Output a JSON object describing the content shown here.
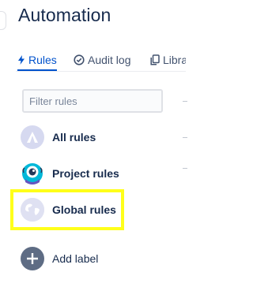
{
  "header": {
    "title": "Automation"
  },
  "tabs": [
    {
      "label": "Rules",
      "icon": "lightning-icon",
      "active": true
    },
    {
      "label": "Audit log",
      "icon": "check-circle-icon",
      "active": false
    },
    {
      "label": "Libra",
      "icon": "copy-icon",
      "active": false
    }
  ],
  "filter": {
    "placeholder": "Filter rules",
    "value": ""
  },
  "sidebar": {
    "items": [
      {
        "label": "All rules",
        "icon": "all-rules-icon"
      },
      {
        "label": "Project rules",
        "icon": "project-avatar-icon"
      },
      {
        "label": "Global rules",
        "icon": "globe-icon"
      }
    ],
    "add_label": {
      "label": "Add label",
      "icon": "plus-circle-icon"
    }
  },
  "colors": {
    "accent": "#0052cc",
    "highlight": "#ffff1a",
    "text": "#172b4d"
  }
}
